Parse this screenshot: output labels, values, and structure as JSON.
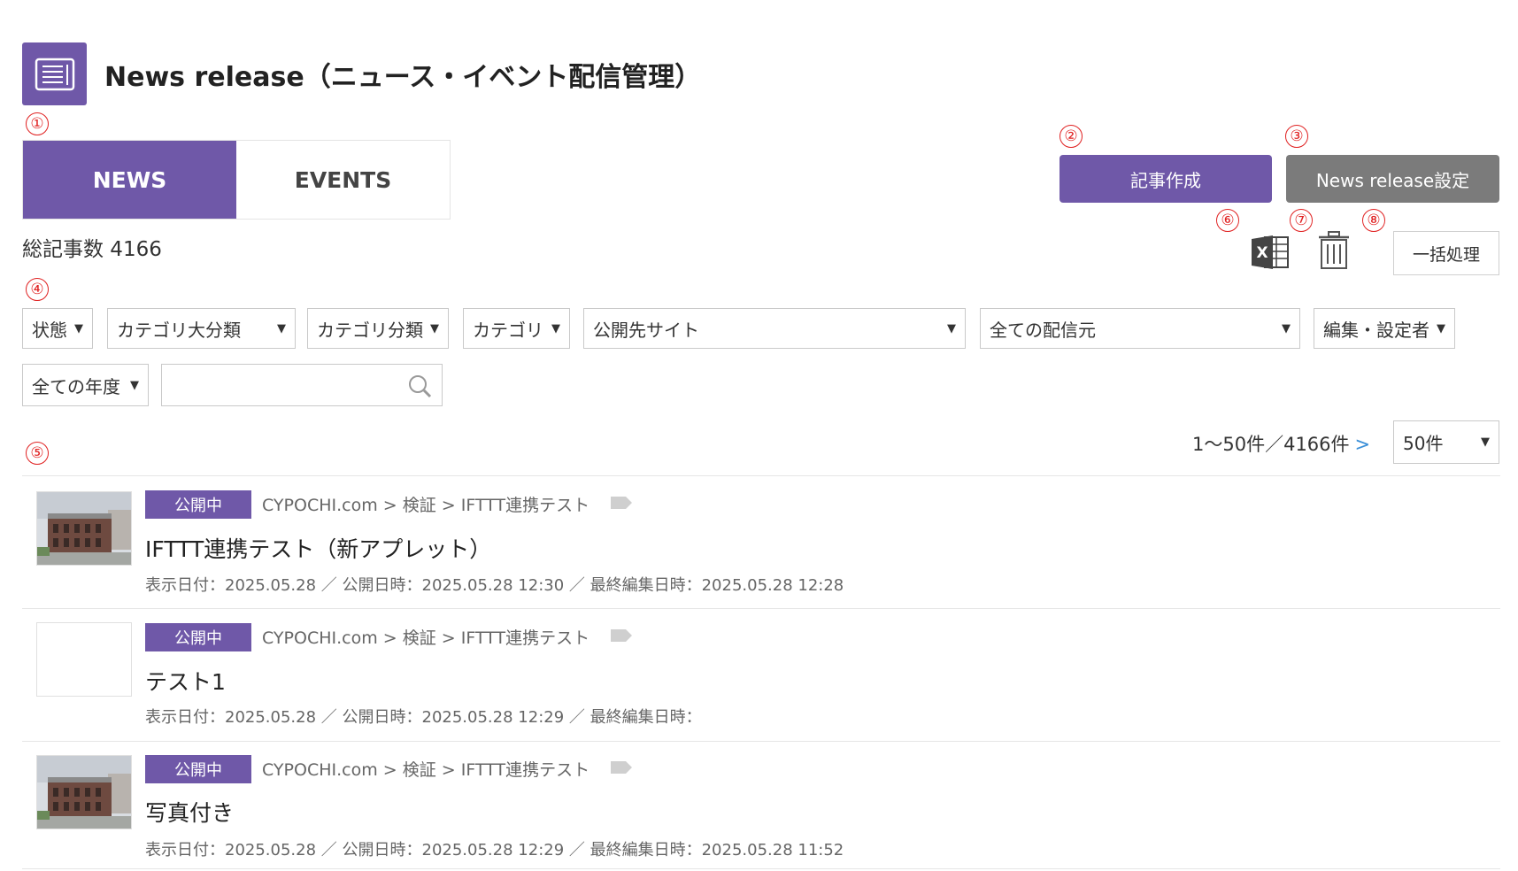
{
  "header": {
    "title": "News release（ニュース・イベント配信管理）"
  },
  "markers": {
    "m1": "①",
    "m2": "②",
    "m3": "③",
    "m4": "④",
    "m5": "⑤",
    "m6": "⑥",
    "m7": "⑦",
    "m8": "⑧"
  },
  "tabs": [
    {
      "label": "NEWS",
      "active": true
    },
    {
      "label": "EVENTS",
      "active": false
    }
  ],
  "actions": {
    "create_label": "記事作成",
    "settings_label": "News release設定",
    "bulk_label": "一括処理"
  },
  "total": {
    "label": "総記事数 4166"
  },
  "filters": {
    "status": "状態",
    "major_category": "カテゴリ大分類",
    "category_class": "カテゴリ分類",
    "category": "カテゴリ",
    "publish_site": "公開先サイト",
    "source": "全ての配信元",
    "editor": "編集・設定者",
    "year": "全ての年度",
    "search_value": ""
  },
  "pagination": {
    "range_text": "1〜50件／4166件",
    "next": ">",
    "per_page": "50件"
  },
  "colors": {
    "accent": "#6f58a8",
    "gray_button": "#7b7b7b",
    "marker": "#e02020",
    "link": "#3a8fd8"
  },
  "articles": [
    {
      "status": "公開中",
      "breadcrumb": "CYPOCHI.com > 検証 > IFTTT連携テスト",
      "title": "IFTTT連携テスト（新アプレット）",
      "meta": "表示日付：2025.05.28 ／ 公開日時：2025.05.28 12:30 ／ 最終編集日時：2025.05.28 12:28",
      "has_thumbnail": true
    },
    {
      "status": "公開中",
      "breadcrumb": "CYPOCHI.com > 検証 > IFTTT連携テスト",
      "title": "テスト1",
      "meta": "表示日付：2025.05.28 ／ 公開日時：2025.05.28 12:29 ／ 最終編集日時：",
      "has_thumbnail": false
    },
    {
      "status": "公開中",
      "breadcrumb": "CYPOCHI.com > 検証 > IFTTT連携テスト",
      "title": "写真付き",
      "meta": "表示日付：2025.05.28 ／ 公開日時：2025.05.28 12:29 ／ 最終編集日時：2025.05.28 11:52",
      "has_thumbnail": true
    }
  ]
}
